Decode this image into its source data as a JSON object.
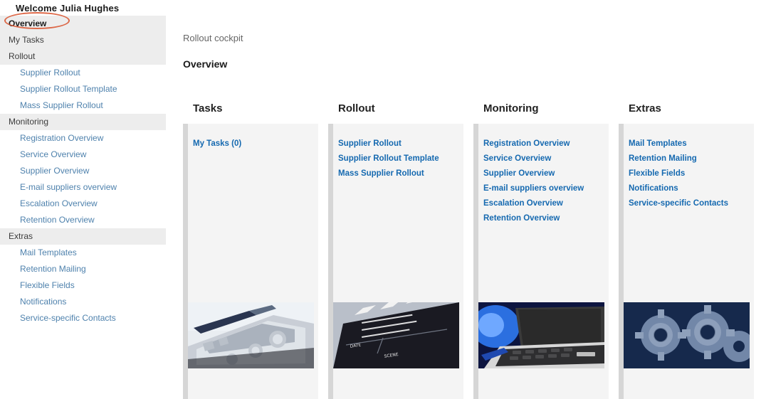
{
  "sidebar": {
    "welcome": "Welcome Julia Hughes",
    "items": [
      {
        "label": "Overview",
        "type": "top",
        "highlighted": true
      },
      {
        "label": "My Tasks",
        "type": "plain"
      },
      {
        "label": "Rollout",
        "type": "section"
      },
      {
        "label": "Supplier Rollout",
        "type": "link"
      },
      {
        "label": "Supplier Rollout Template",
        "type": "link"
      },
      {
        "label": "Mass Supplier Rollout",
        "type": "link"
      },
      {
        "label": "Monitoring",
        "type": "section"
      },
      {
        "label": "Registration Overview",
        "type": "link"
      },
      {
        "label": "Service Overview",
        "type": "link"
      },
      {
        "label": "Supplier Overview",
        "type": "link"
      },
      {
        "label": "E-mail suppliers overview",
        "type": "link"
      },
      {
        "label": "Escalation Overview",
        "type": "link"
      },
      {
        "label": "Retention Overview",
        "type": "link"
      },
      {
        "label": "Extras",
        "type": "section"
      },
      {
        "label": "Mail Templates",
        "type": "link"
      },
      {
        "label": "Retention Mailing",
        "type": "link"
      },
      {
        "label": "Flexible Fields",
        "type": "link"
      },
      {
        "label": "Notifications",
        "type": "link"
      },
      {
        "label": "Service-specific Contacts",
        "type": "link"
      }
    ]
  },
  "main": {
    "breadcrumb": "Rollout cockpit",
    "title": "Overview"
  },
  "panels": [
    {
      "title": "Tasks",
      "links": [
        "My Tasks (0)"
      ],
      "image": "pda-stylus-photo"
    },
    {
      "title": "Rollout",
      "links": [
        "Supplier Rollout",
        "Supplier Rollout Template",
        "Mass Supplier Rollout"
      ],
      "image": "clapperboard-photo"
    },
    {
      "title": "Monitoring",
      "links": [
        "Registration Overview",
        "Service Overview",
        "Supplier Overview",
        "E-mail suppliers overview",
        "Escalation Overview",
        "Retention Overview"
      ],
      "image": "laptop-photo"
    },
    {
      "title": "Extras",
      "links": [
        "Mail Templates",
        "Retention Mailing",
        "Flexible Fields",
        "Notifications",
        "Service-specific Contacts"
      ],
      "image": "gears-photo"
    }
  ],
  "colors": {
    "panel_link": "#1569b0",
    "sidebar_link": "#4f82ad",
    "annotation": "#d8502a",
    "panel_body_bg": "#f4f4f4",
    "section_bg": "#ededed"
  }
}
